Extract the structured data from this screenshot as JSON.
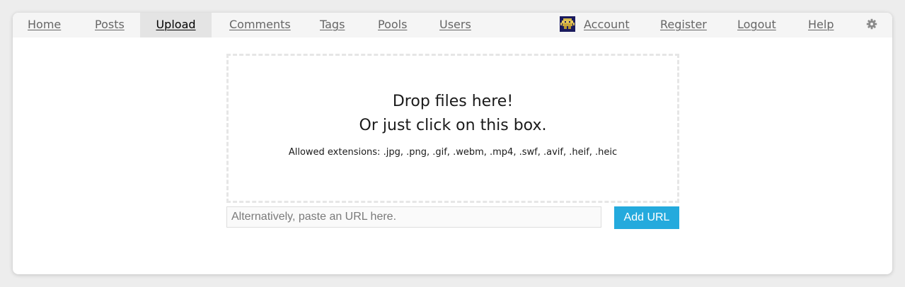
{
  "nav": {
    "items": [
      {
        "label": "Home"
      },
      {
        "label": "Posts"
      },
      {
        "label": "Upload",
        "active": true
      },
      {
        "label": "Comments"
      },
      {
        "label": "Tags"
      },
      {
        "label": "Pools"
      },
      {
        "label": "Users"
      }
    ],
    "account_label": "Account",
    "register_label": "Register",
    "logout_label": "Logout",
    "help_label": "Help",
    "settings_icon": "gear-icon"
  },
  "upload": {
    "drop_line1": "Drop files here!",
    "drop_line2": "Or just click on this box.",
    "allowed_extensions": "Allowed extensions: .jpg, .png, .gif, .webm, .mp4, .swf, .avif, .heif, .heic",
    "url_placeholder": "Alternatively, paste an URL here.",
    "url_value": "",
    "add_url_label": "Add URL"
  },
  "colors": {
    "accent": "#24aadd",
    "nav_background": "#f5f5f5",
    "active_tab_background": "#e4e4e4",
    "avatar_background": "#1b1b5e"
  }
}
